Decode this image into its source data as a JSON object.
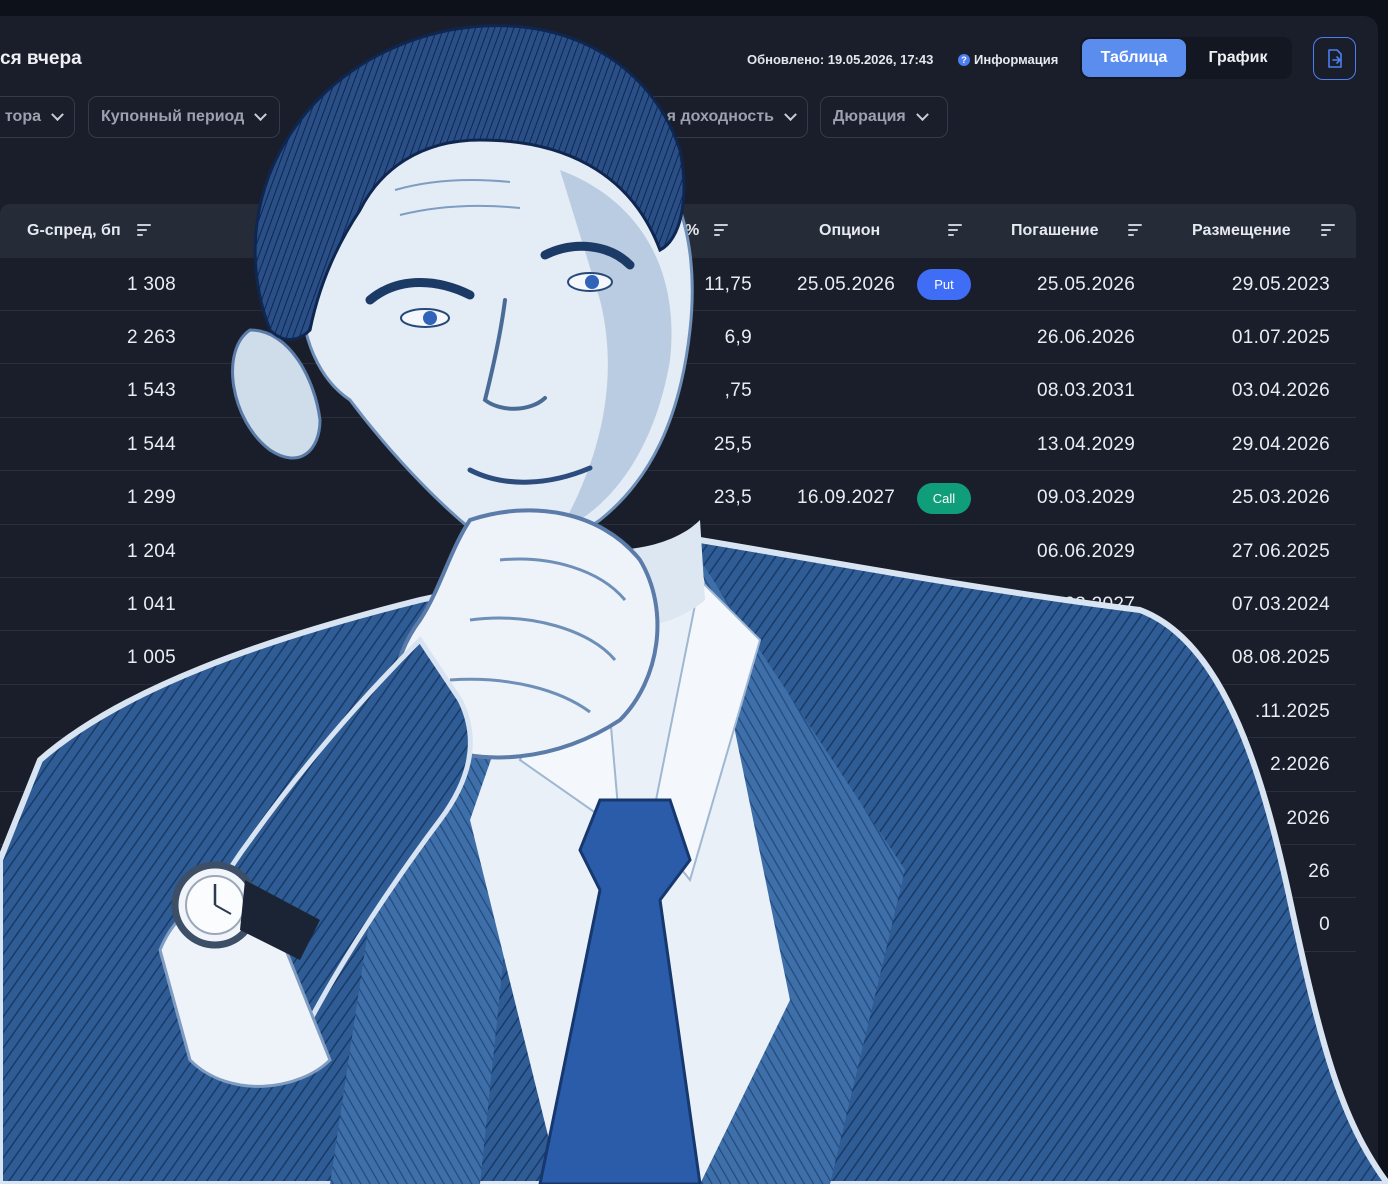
{
  "header": {
    "title": "ся вчера",
    "updated": "Обновлено: 19.05.2026, 17:43",
    "info_label": "Информация",
    "view_table": "Таблица",
    "view_chart": "График"
  },
  "filters": [
    {
      "label": "тора"
    },
    {
      "label": "Купонный период"
    },
    {
      "label": "ая доходность"
    },
    {
      "label": "Дюрация"
    }
  ],
  "columns": {
    "gspread": "G-спред, бп",
    "coupon_pct": "%",
    "option": "Опцион",
    "maturity": "Погашение",
    "placement": "Размещение"
  },
  "rows": [
    {
      "gspread": "1 308",
      "coupon": "11,75",
      "option_date": "25.05.2026",
      "option_type": "Put",
      "maturity": "25.05.2026",
      "placement": "29.05.2023"
    },
    {
      "gspread": "2 263",
      "coupon": "6,9",
      "option_date": "",
      "option_type": "",
      "maturity": "26.06.2026",
      "placement": "01.07.2025"
    },
    {
      "gspread": "1 543",
      "coupon": ",75",
      "option_date": "",
      "option_type": "",
      "maturity": "08.03.2031",
      "placement": "03.04.2026"
    },
    {
      "gspread": "1 544",
      "coupon": "25,5",
      "option_date": "",
      "option_type": "",
      "maturity": "13.04.2029",
      "placement": "29.04.2026"
    },
    {
      "gspread": "1 299",
      "coupon": "23,5",
      "option_date": "16.09.2027",
      "option_type": "Call",
      "maturity": "09.03.2029",
      "placement": "25.03.2026"
    },
    {
      "gspread": "1 204",
      "coupon": "",
      "option_date": "",
      "option_type": "",
      "maturity": "06.06.2029",
      "placement": "27.06.2025"
    },
    {
      "gspread": "1 041",
      "coupon": "",
      "option_date": "",
      "option_type": "",
      "maturity": "29.03.2027",
      "placement": "07.03.2024"
    },
    {
      "gspread": "1 005",
      "coupon": "",
      "option_date": "",
      "option_type": "",
      "maturity": "",
      "placement": "08.08.2025"
    },
    {
      "gspread": "",
      "coupon": "",
      "option_date": "",
      "option_type": "",
      "maturity": "",
      "placement": ".11.2025"
    },
    {
      "gspread": "",
      "coupon": "",
      "option_date": "",
      "option_type": "",
      "maturity": "",
      "placement": "2.2026"
    },
    {
      "gspread": "",
      "coupon": "",
      "option_date": "",
      "option_type": "",
      "maturity": "",
      "placement": "2026"
    },
    {
      "gspread": "",
      "coupon": "",
      "option_date": "",
      "option_type": "",
      "maturity": "",
      "placement": "26"
    },
    {
      "gspread": "",
      "coupon": "",
      "option_date": "",
      "option_type": "",
      "maturity": "",
      "placement": "0"
    }
  ],
  "colors": {
    "accent": "#5b8def",
    "put_badge": "#3f6df5",
    "call_badge": "#0f9e79",
    "background": "#1a1e2a",
    "header_row": "#262b38"
  },
  "icons": {
    "sort": "sort-lines-icon",
    "chevron": "chevron-down-icon",
    "info": "info-circle-icon",
    "export": "export-file-icon"
  },
  "illustration": {
    "subject": "sketched-businessman-thinking"
  }
}
